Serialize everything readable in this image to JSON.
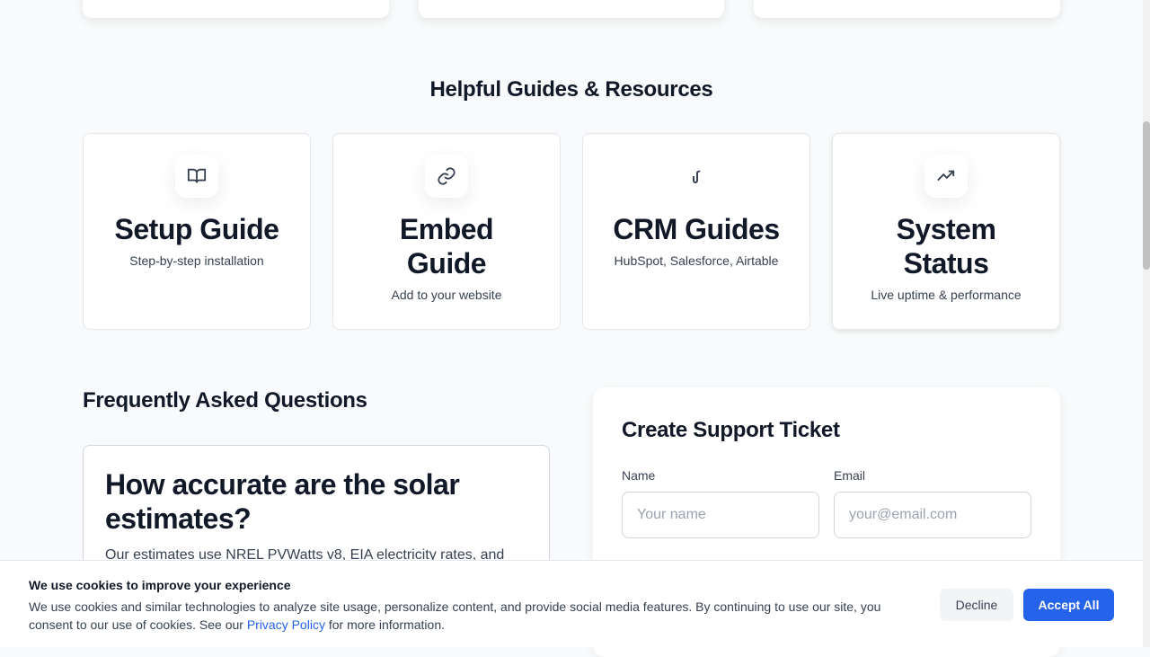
{
  "guides_section": {
    "title": "Helpful Guides & Resources",
    "items": [
      {
        "icon": "book-open-icon",
        "title": "Setup Guide",
        "subtitle": "Step-by-step installation"
      },
      {
        "icon": "link-icon",
        "title": "Embed Guide",
        "subtitle": "Add to your website"
      },
      {
        "icon": "hook-icon",
        "title": "CRM Guides",
        "subtitle": "HubSpot, Salesforce, Airtable"
      },
      {
        "icon": "trending-up-icon",
        "title": "System Status",
        "subtitle": "Live uptime & performance"
      }
    ]
  },
  "faq": {
    "title": "Frequently Asked Questions",
    "items": [
      {
        "question": "How accurate are the solar estimates?",
        "answer": "Our estimates use NREL PVWatts v8, EIA electricity rates, and"
      }
    ]
  },
  "ticket": {
    "title": "Create Support Ticket",
    "name_label": "Name",
    "name_placeholder": "Your name",
    "email_label": "Email",
    "email_placeholder": "your@email.com"
  },
  "cookie": {
    "title": "We use cookies to improve your experience",
    "text": "We use cookies and similar technologies to analyze site usage, personalize content, and provide social media features. By continuing to use our site, you consent to our use of cookies. See our ",
    "link": "Privacy Policy",
    "text_after": " for more information.",
    "decline": "Decline",
    "accept": "Accept All",
    "accent": "#2563eb"
  }
}
